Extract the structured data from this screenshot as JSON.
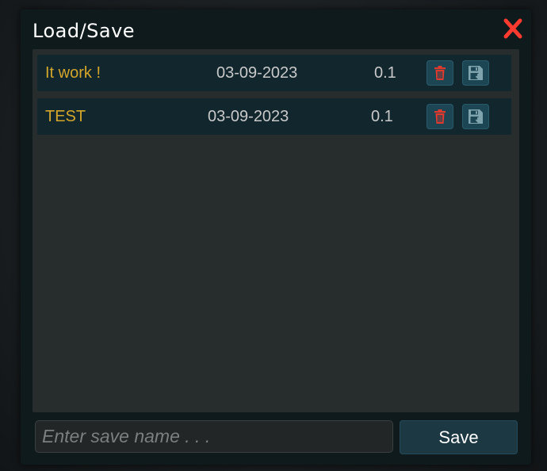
{
  "dialog": {
    "title": "Load/Save",
    "close_icon": "close-x-icon",
    "accent_close_color": "#ff3b30"
  },
  "saves": [
    {
      "name": "It work !",
      "date": "03-09-2023",
      "version": "0.1"
    },
    {
      "name": "TEST",
      "date": "03-09-2023",
      "version": "0.1"
    }
  ],
  "row_actions": {
    "delete_icon": "trash-icon",
    "load_icon": "floppy-disk-icon"
  },
  "footer": {
    "input_value": "",
    "input_placeholder": "Enter save name . . .",
    "save_label": "Save"
  },
  "colors": {
    "name_text": "#d4a62a",
    "delete_icon": "#e03a2f",
    "load_icon": "#7fa4ae"
  }
}
